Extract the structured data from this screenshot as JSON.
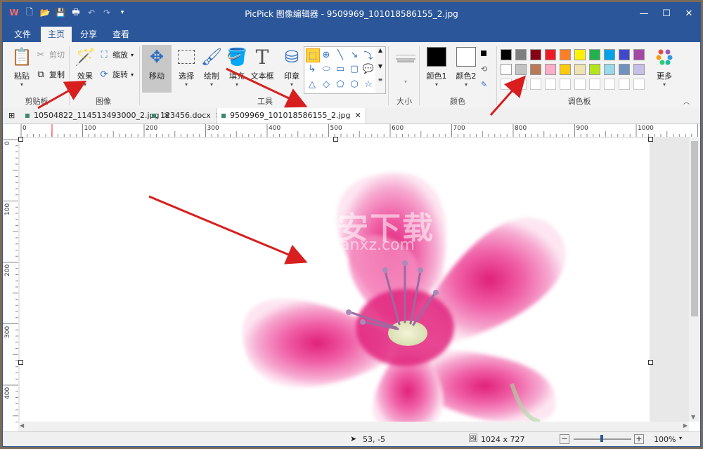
{
  "window": {
    "title": "PicPick 图像编辑器 - 9509969_101018586155_2.jpg",
    "controls": [
      "—",
      "☐",
      "✕"
    ]
  },
  "menu": {
    "tabs": [
      {
        "label": "文件",
        "active": false
      },
      {
        "label": "主页",
        "active": true
      },
      {
        "label": "分享",
        "active": false
      },
      {
        "label": "查看",
        "active": false
      }
    ]
  },
  "ribbon": {
    "clipboard": {
      "paste": "粘贴",
      "cut": "剪切",
      "copy": "复制",
      "group": "剪贴板"
    },
    "image": {
      "effects": "效果",
      "resize": "缩放",
      "rotate": "旋转",
      "group": "图像"
    },
    "tools": {
      "move": "移动",
      "select": "选择",
      "draw": "绘制",
      "fill": "填充",
      "textbox": "文本框",
      "stamp": "印章",
      "group": "工具"
    },
    "size": {
      "group": "大小"
    },
    "colors": {
      "color1": "颜色1",
      "color2": "颜色2",
      "group": "颜色"
    },
    "palette": {
      "group": "调色板",
      "more": "更多",
      "row1": [
        "#000000",
        "#7f7f7f",
        "#880015",
        "#ed1c24",
        "#ff7f27",
        "#fff200",
        "#22b14c",
        "#00a2e8",
        "#3f48cc",
        "#a349a4"
      ],
      "row2": [
        "#ffffff",
        "#c3c3c3",
        "#b97a57",
        "#ffaec9",
        "#ffc90e",
        "#efe4b0",
        "#b5e61d",
        "#99d9ea",
        "#7092be",
        "#c8bfe7"
      ]
    }
  },
  "doc_tabs": [
    {
      "label": "10504822_114513493000_2.jpg",
      "active": false
    },
    {
      "label": "123456.docx",
      "active": false
    },
    {
      "label": "9509969_101018586155_2.jpg",
      "active": true
    }
  ],
  "ruler": {
    "h_labels": [
      "0",
      "100",
      "200",
      "300",
      "400",
      "500",
      "600",
      "700",
      "800",
      "900",
      "1000"
    ],
    "v_labels": [
      "0",
      "100",
      "200",
      "300",
      "400"
    ]
  },
  "watermark": {
    "cn": "安下载",
    "en": "anxz.com"
  },
  "status": {
    "cursor": "53, -5",
    "dimensions": "1024 x 727",
    "zoom": "100%"
  }
}
